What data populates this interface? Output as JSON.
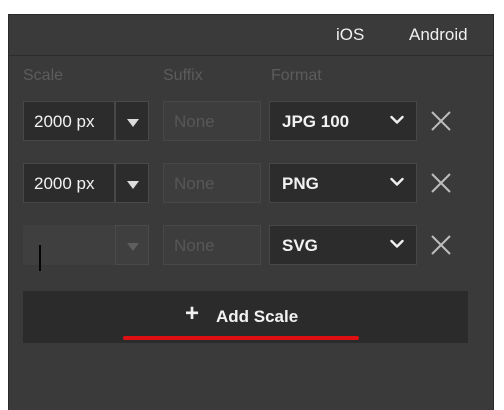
{
  "tabs": [
    {
      "label": "iOS"
    },
    {
      "label": "Android"
    }
  ],
  "headers": {
    "scale": "Scale",
    "suffix": "Suffix",
    "format": "Format"
  },
  "rows": [
    {
      "scale": "2000 px",
      "suffix_placeholder": "None",
      "format": "JPG 100"
    },
    {
      "scale": "2000 px",
      "suffix_placeholder": "None",
      "format": "PNG"
    },
    {
      "scale": "",
      "suffix_placeholder": "None",
      "format": "SVG"
    }
  ],
  "add_scale": {
    "plus": "+",
    "label": "Add Scale"
  },
  "colors": {
    "panel": "#3a3a3a",
    "field": "#2c2c2c",
    "annotation_underline": "#e00f12"
  },
  "icons": {
    "scale_dropdown": "triangle-down-icon",
    "format_dropdown": "chevron-down-icon",
    "remove": "close-icon",
    "add": "plus-icon"
  }
}
